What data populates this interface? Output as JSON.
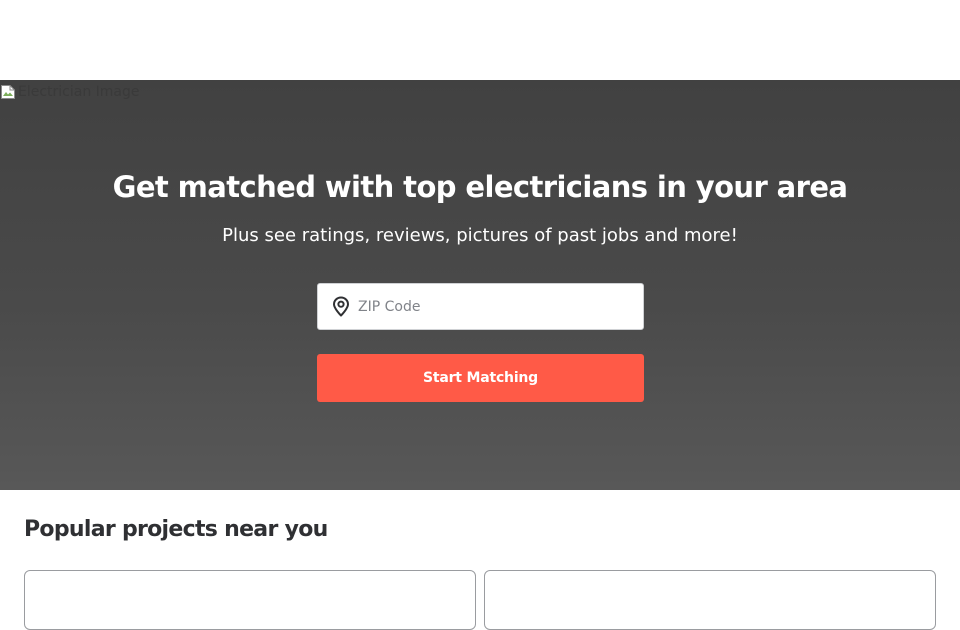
{
  "hero": {
    "image_alt": "Electrician Image",
    "title": "Get matched with top electricians in your area",
    "subtitle": "Plus see ratings, reviews, pictures of past jobs and more!"
  },
  "zip": {
    "placeholder": "ZIP Code",
    "value": "",
    "icon": "map-pin-icon"
  },
  "cta": {
    "label": "Start Matching",
    "color": "#ff5a47"
  },
  "projects": {
    "title": "Popular projects near you"
  },
  "colors": {
    "hero_bg": "#444444",
    "accent": "#ff5a47",
    "text": "#2f3033"
  }
}
